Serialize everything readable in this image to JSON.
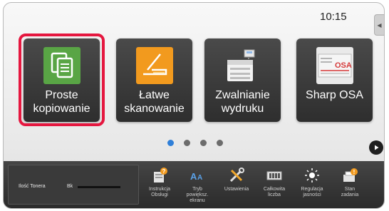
{
  "clock": "10:15",
  "tiles": [
    {
      "label_line1": "Proste",
      "label_line2": "kopiowanie",
      "icon": "copy-icon",
      "color": "#59a545"
    },
    {
      "label_line1": "Łatwe",
      "label_line2": "skanowanie",
      "icon": "scanner-icon",
      "color": "#f29a1e"
    },
    {
      "label_line1": "Zwalnianie",
      "label_line2": "wydruku",
      "icon": "printer-release-icon"
    },
    {
      "label_line1": "Sharp OSA",
      "label_line2": "",
      "icon": "osa-icon",
      "icon_text": "OSA"
    }
  ],
  "highlight_color": "#e5173f",
  "page_dots": {
    "count": 4,
    "active_index": 0,
    "active_color": "#2f7fd8"
  },
  "toner": {
    "label": "Ilość Tonera",
    "bk_label": "Bk"
  },
  "shortcuts": [
    {
      "line1": "Instrukcja",
      "line2": "Obsługi",
      "line3": "",
      "icon": "book-icon"
    },
    {
      "line1": "Tryb",
      "line2": "powiększ.",
      "line3": "ekranu",
      "icon": "text-magnify-icon"
    },
    {
      "line1": "Ustawienia",
      "line2": "",
      "line3": "",
      "icon": "tools-icon"
    },
    {
      "line1": "Całkowita",
      "line2": "liczba",
      "line3": "",
      "icon": "counter-icon"
    },
    {
      "line1": "Regulacja",
      "line2": "jasności",
      "line3": "",
      "icon": "brightness-icon"
    },
    {
      "line1": "Stan",
      "line2": "zadania",
      "line3": "",
      "icon": "job-status-icon"
    }
  ]
}
